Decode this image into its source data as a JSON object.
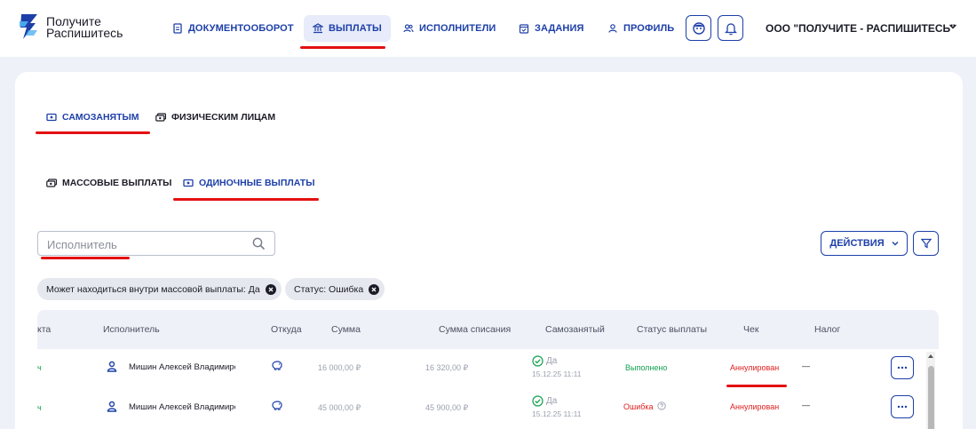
{
  "brand": {
    "line1": "Получите",
    "line2": "Распишитесь"
  },
  "nav": [
    {
      "label": "ДОКУМЕНТООБОРОТ",
      "icon": "document-icon"
    },
    {
      "label": "ВЫПЛАТЫ",
      "icon": "bank-icon",
      "active": true
    },
    {
      "label": "ИСПОЛНИТЕЛИ",
      "icon": "users-icon"
    },
    {
      "label": "ЗАДАНИЯ",
      "icon": "calendar-icon"
    },
    {
      "label": "ПРОФИЛЬ",
      "icon": "user-icon"
    }
  ],
  "company": "ООО \"ПОЛУЧИТЕ - РАСПИШИТЕСЬ\"",
  "tabs_top": [
    {
      "label": "САМОЗАНЯТЫМ",
      "active": true
    },
    {
      "label": "ФИЗИЧЕСКИМ ЛИЦАМ",
      "active": false
    }
  ],
  "tabs_sub": [
    {
      "label": "МАССОВЫЕ ВЫПЛАТЫ",
      "active": false
    },
    {
      "label": "ОДИНОЧНЫЕ ВЫПЛАТЫ",
      "active": true
    }
  ],
  "search": {
    "placeholder": "Исполнитель",
    "value": ""
  },
  "actions_label": "ДЕЙСТВИЯ",
  "filters": [
    "Может находиться внутри массовой выплаты: Да",
    "Статус: Ошибка"
  ],
  "table": {
    "columns": [
      "кта",
      "Исполнитель",
      "Откуда",
      "Сумма",
      "Сумма списания",
      "Самозанятый",
      "Статус выплаты",
      "Чек",
      "Налог"
    ],
    "rows": [
      {
        "lead": "ч",
        "executor": "Мишин Алексей Владимирович",
        "amount": "16 000,00 ₽",
        "debit": "16 320,00 ₽",
        "self_employed": "Да",
        "date": "15.12.25 11:11",
        "status": "Выполнено",
        "check": "Аннулирован",
        "tax": "—"
      },
      {
        "lead": "ч",
        "executor": "Мишин Алексей Владимирович",
        "amount": "45 000,00 ₽",
        "debit": "45 900,00 ₽",
        "self_employed": "Да",
        "date": "15.12.25 11:11",
        "status": "Ошибка",
        "check": "Аннулирован",
        "tax": "—"
      }
    ]
  },
  "colors": {
    "accent": "#1d3fa8",
    "highlight": "#e41010",
    "success": "#12a150",
    "error": "#e02020"
  }
}
